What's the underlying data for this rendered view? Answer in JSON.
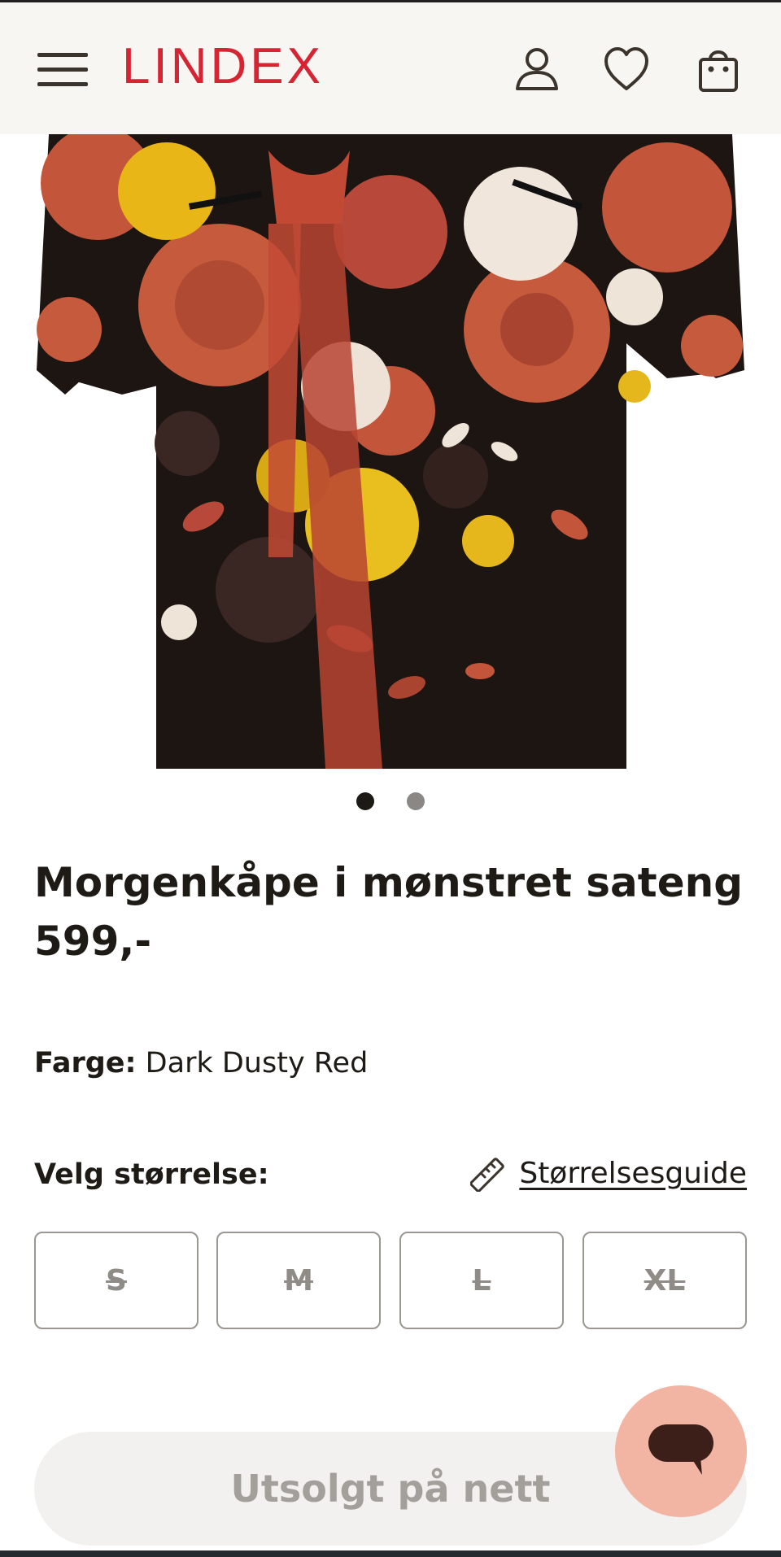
{
  "header": {
    "logo": "LINDEX",
    "menu_icon": "hamburger-menu-icon",
    "account_icon": "user-icon",
    "wishlist_icon": "heart-icon",
    "cart_icon": "shopping-bag-icon"
  },
  "gallery": {
    "image_count": 2,
    "active_index": 1
  },
  "product": {
    "title": "Morgenkåpe i mønstret sateng",
    "price": "599,-",
    "color_label": "Farge:",
    "color_value": "Dark Dusty Red"
  },
  "sizes": {
    "label": "Velg størrelse:",
    "guide_label": "Størrelsesguide",
    "guide_icon": "ruler-icon",
    "options": [
      "S",
      "M",
      "L",
      "XL"
    ]
  },
  "cta": {
    "label": "Utsolgt på nett"
  },
  "chat": {
    "icon": "chat-bubble-icon"
  },
  "colors": {
    "brand_red": "#d62433",
    "header_bg": "#f8f6f2",
    "chat_bg": "#f3b5a3",
    "soldout_bg": "#f2f1ef"
  }
}
